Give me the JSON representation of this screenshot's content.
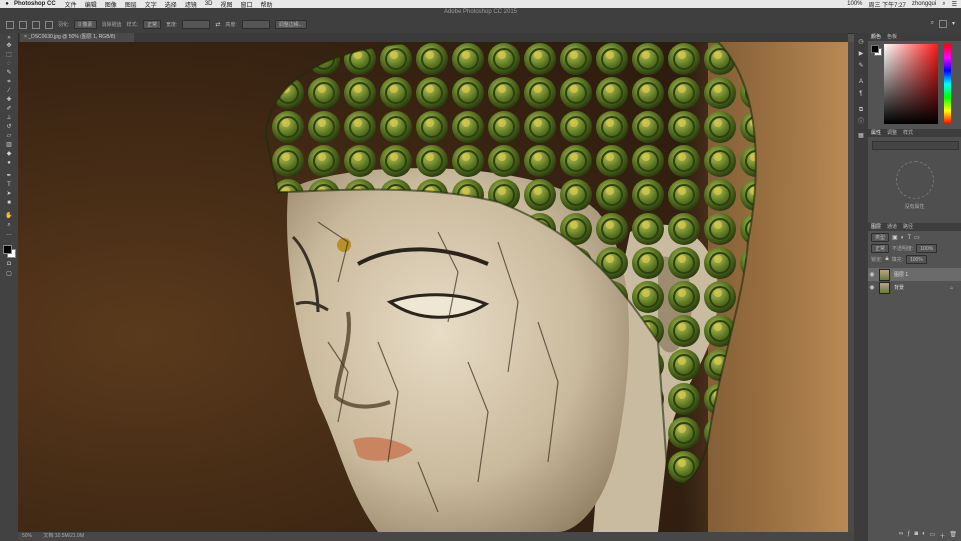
{
  "menubar": {
    "apple": "",
    "app_name": "Photoshop CC",
    "items": [
      "文件",
      "编辑",
      "图像",
      "图层",
      "文字",
      "选择",
      "滤镜",
      "3D",
      "视图",
      "窗口",
      "帮助"
    ],
    "status": "100%",
    "time": "周三 下午7:27",
    "user": "zhongqui"
  },
  "window_title": "Adobe Photoshop CC 2015",
  "options": {
    "tool_preset": "调整边缘...",
    "feather_label": "羽化:",
    "feather_value": "0 像素",
    "antialias": "消除锯齿",
    "style_label": "样式:",
    "style_value": "正常",
    "width_label": "宽度:",
    "height_label": "高度:",
    "refine_button": "调整边缘..."
  },
  "document_tab": "_DSC0630.jpg @ 50% (图层 1, RGB/8)",
  "status_bar": {
    "zoom": "50%",
    "doc_info": "文档:10.5M/21.0M"
  },
  "panels": {
    "color_tabs": [
      "颜色",
      "色板"
    ],
    "properties_tabs": [
      "属性",
      "调整",
      "样式"
    ],
    "properties_note": "没有属性",
    "layers_tabs": [
      "图层",
      "通道",
      "路径"
    ],
    "kind_label": "类型",
    "blend_mode": "正常",
    "opacity_label": "不透明度:",
    "opacity_value": "100%",
    "lock_label": "锁定:",
    "fill_label": "填充:",
    "fill_value": "100%",
    "layers": [
      {
        "name": "图层 1",
        "selected": true
      },
      {
        "name": "背景",
        "selected": false
      }
    ]
  },
  "icons": {
    "toolbar": [
      "move-icon",
      "marquee-icon",
      "lasso-icon",
      "quick-select-icon",
      "crop-icon",
      "eyedropper-icon",
      "healing-icon",
      "brush-icon",
      "clone-icon",
      "history-brush-icon",
      "eraser-icon",
      "gradient-icon",
      "blur-icon",
      "dodge-icon",
      "pen-icon",
      "type-icon",
      "path-select-icon",
      "shape-icon",
      "hand-icon",
      "zoom-icon"
    ],
    "dock": [
      "history-icon",
      "actions-icon",
      "brush-preset-icon",
      "character-icon",
      "paragraph-icon",
      "layer-comp-icon",
      "info-icon",
      "swatches-icon"
    ]
  },
  "colors": {
    "foreground": "#000000",
    "background": "#ffffff",
    "hue_selected": "#ff1a1a"
  }
}
